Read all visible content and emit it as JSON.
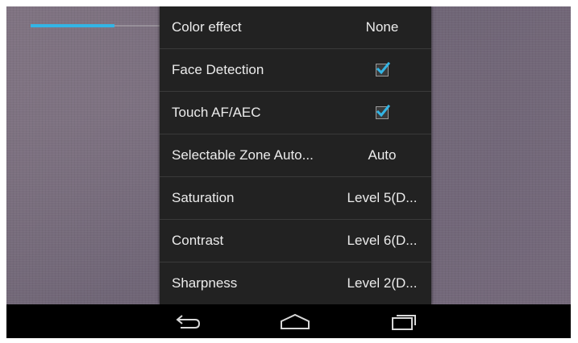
{
  "progress": {
    "fraction": 0.65
  },
  "settings_menu": {
    "items": [
      {
        "label": "Color effect",
        "value": "None"
      },
      {
        "label": "Face Detection",
        "checked": true
      },
      {
        "label": "Touch AF/AEC",
        "checked": true
      },
      {
        "label": "Selectable Zone Auto...",
        "value": "Auto"
      },
      {
        "label": "Saturation",
        "value": "Level 5(D..."
      },
      {
        "label": "Contrast",
        "value": "Level 6(D..."
      },
      {
        "label": "Sharpness",
        "value": "Level 2(D..."
      }
    ]
  },
  "nav_bar": {
    "icons": [
      "back-icon",
      "home-icon",
      "recent-apps-icon"
    ]
  },
  "colors": {
    "accent": "#33b5e5",
    "menu_background": "#222222",
    "nav_background": "#000000"
  }
}
